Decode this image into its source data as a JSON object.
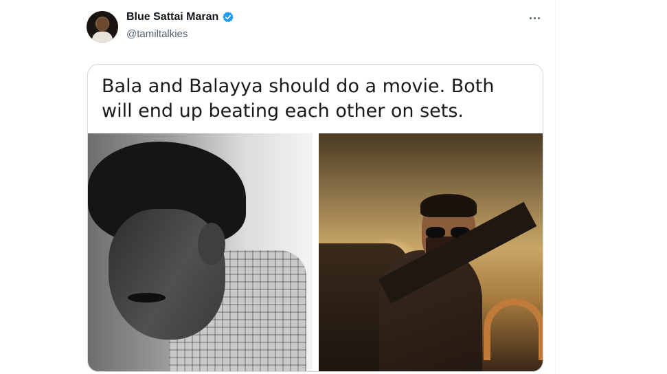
{
  "tweet": {
    "author": {
      "display_name": "Blue Sattai Maran",
      "handle": "@tamiltalkies",
      "verified": true,
      "avatar_icon": "profile-photo"
    },
    "more_icon": "ellipsis-icon",
    "media": {
      "caption": "Bala and Balayya should do a movie. Both will end up beating each other on sets.",
      "left_photo": "black-and-white-portrait",
      "right_photo": "movie-poster-man-with-sunglasses-on-jeep"
    }
  },
  "colors": {
    "text_primary": "#0f1419",
    "text_secondary": "#536471",
    "verified_blue": "#1d9bf0",
    "border": "#cfd9de"
  }
}
